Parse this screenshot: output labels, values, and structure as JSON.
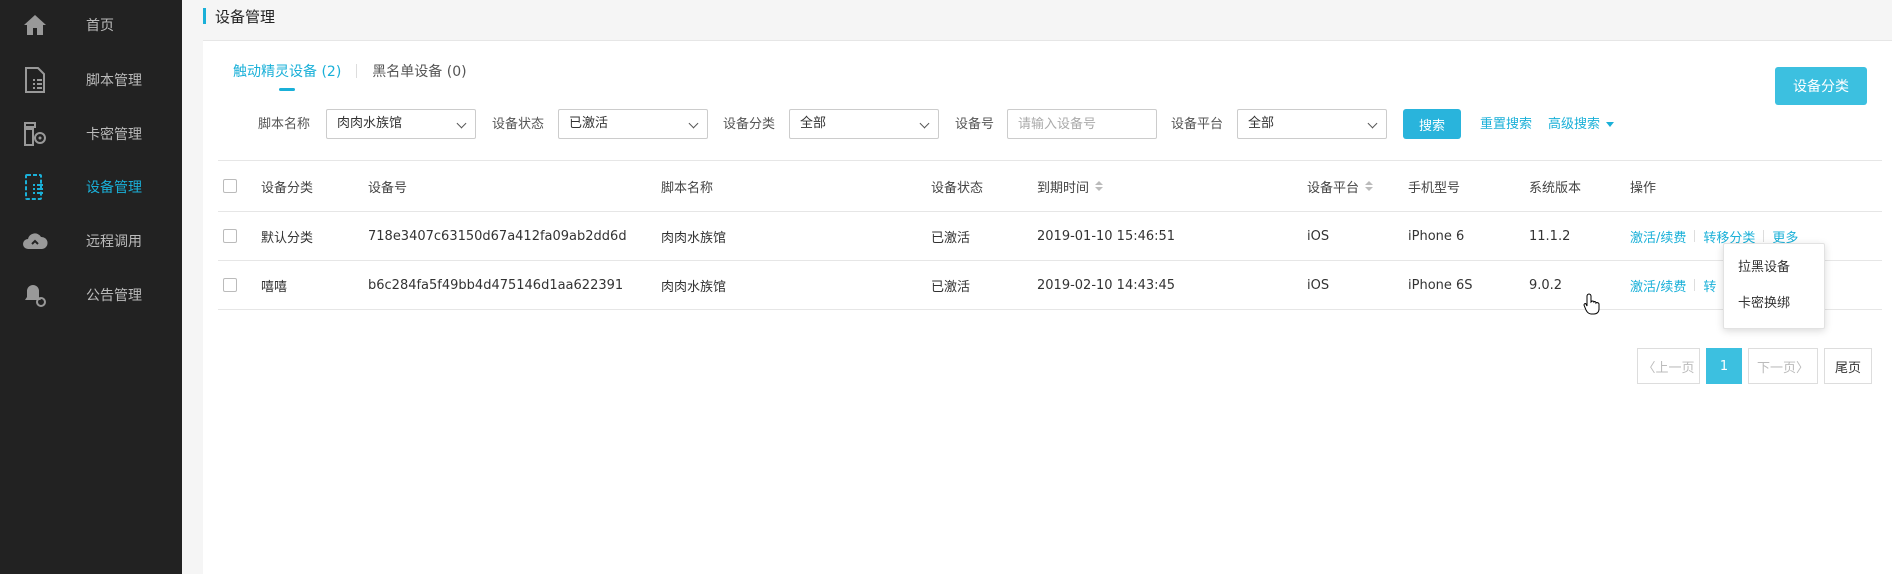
{
  "sidebar": {
    "items": [
      {
        "label": "首页",
        "icon": "home-icon"
      },
      {
        "label": "脚本管理",
        "icon": "script-icon"
      },
      {
        "label": "卡密管理",
        "icon": "card-key-icon"
      },
      {
        "label": "设备管理",
        "icon": "device-icon",
        "active": true
      },
      {
        "label": "远程调用",
        "icon": "cloud-icon"
      },
      {
        "label": "公告管理",
        "icon": "bell-icon"
      }
    ]
  },
  "header": {
    "title": "设备管理"
  },
  "tabs": [
    {
      "label": "触动精灵设备 (2)",
      "active": true
    },
    {
      "label": "黑名单设备 (0)",
      "active": false
    }
  ],
  "category_button": "设备分类",
  "filters": {
    "script_label": "脚本名称",
    "script_value": "肉肉水族馆",
    "status_label": "设备状态",
    "status_value": "已激活",
    "category_label": "设备分类",
    "category_value": "全部",
    "device_label": "设备号",
    "device_placeholder": "请输入设备号",
    "platform_label": "设备平台",
    "platform_value": "全部",
    "search_button": "搜索",
    "reset_link": "重置搜索",
    "advanced_link": "高级搜索"
  },
  "table": {
    "headers": [
      "设备分类",
      "设备号",
      "脚本名称",
      "设备状态",
      "到期时间",
      "设备平台",
      "手机型号",
      "系统版本",
      "操作"
    ],
    "rows": [
      {
        "category": "默认分类",
        "device": "718e3407c63150d67a412fa09ab2dd6d",
        "script": "肉肉水族馆",
        "status": "已激活",
        "expire": "2019-01-10 15:46:51",
        "platform": "iOS",
        "model": "iPhone 6",
        "os": "11.1.2"
      },
      {
        "category": "嘻嘻",
        "device": "b6c284fa5f49bb4d475146d1aa622391",
        "script": "肉肉水族馆",
        "status": "已激活",
        "expire": "2019-02-10 14:43:45",
        "platform": "iOS",
        "model": "iPhone 6S",
        "os": "9.0.2"
      }
    ],
    "actions": {
      "activate": "激活/续费",
      "transfer": "转移分类",
      "more": "更多",
      "transfer_partial": "转"
    }
  },
  "more_menu": [
    "拉黑设备",
    "卡密换绑"
  ],
  "pagination": {
    "prev": "〈上一页",
    "current": "1",
    "next": "下一页〉",
    "last": "尾页"
  },
  "colors": {
    "accent": "#1ab0d8",
    "sidebar_bg": "#222222"
  }
}
